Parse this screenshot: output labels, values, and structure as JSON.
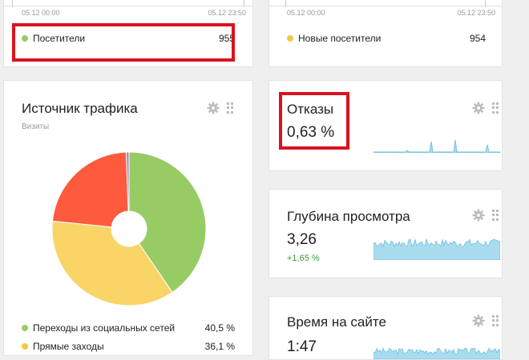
{
  "colors": {
    "green": "#97cc64",
    "yellow": "#f5c842",
    "red": "#fd5a3e",
    "purple": "#9b8ec4",
    "highlight": "#d9141f",
    "sparkline": "#a9dcef"
  },
  "top_left": {
    "time_start": "05.12 00:00",
    "time_end": "05.12 23:50",
    "legend_label": "Посетители",
    "legend_value": "955"
  },
  "top_right": {
    "time_start": "05.12 00:00",
    "time_end": "05.12 23:50",
    "legend_label": "Новые посетители",
    "legend_value": "954"
  },
  "traffic": {
    "title": "Источник трафика",
    "subtitle": "Визиты",
    "icons": [
      "gear-icon",
      "drag-handle-icon"
    ],
    "legend": [
      {
        "label": "Переходы из социальных сетей",
        "value": "40,5 %"
      },
      {
        "label": "Прямые заходы",
        "value": "36,1 %"
      }
    ],
    "chart_data": {
      "type": "pie",
      "categories": [
        "Переходы из социальных сетей",
        "Прямые заходы",
        "",
        ""
      ],
      "values": [
        40.5,
        36.1,
        22.8,
        0.6
      ],
      "colors": [
        "#97cc64",
        "#f9d567",
        "#fd5a3e",
        "#9b8ec4"
      ],
      "donut": true
    }
  },
  "bounce": {
    "title": "Отказы",
    "value": "0,63 %"
  },
  "depth": {
    "title": "Глубина просмотра",
    "value": "3,26",
    "delta": "+1,65 %"
  },
  "time_on_site": {
    "title": "Время на сайте",
    "value": "1:47"
  }
}
